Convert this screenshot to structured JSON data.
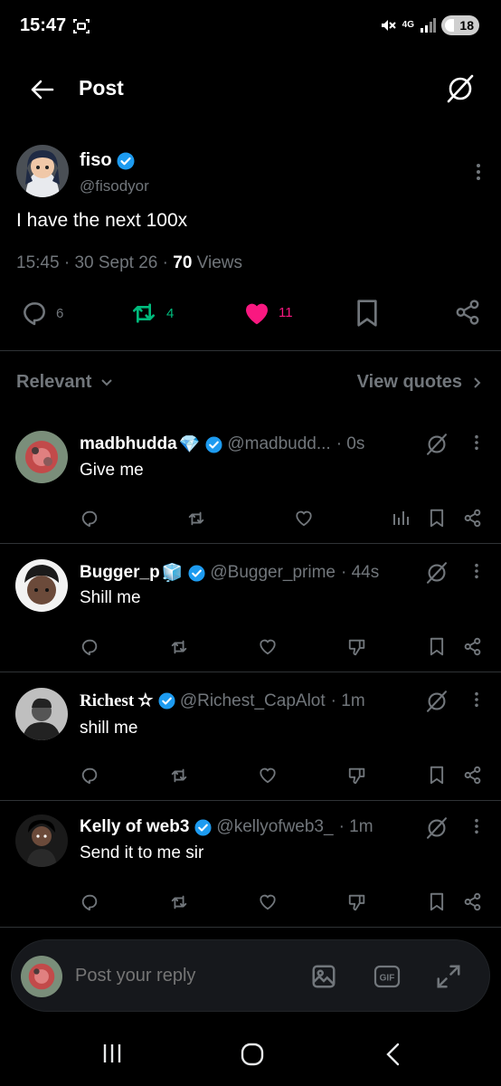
{
  "status_bar": {
    "time": "15:47",
    "network": "4G",
    "battery": "18"
  },
  "header": {
    "title": "Post"
  },
  "post": {
    "author_name": "fiso",
    "author_handle": "@fisodyor",
    "text": "I have the next 100x",
    "time": "15:45",
    "date": "30 Sept 26",
    "views_count": "70",
    "views_label": "Views",
    "replies": "6",
    "reposts": "4",
    "likes": "11",
    "colors": {
      "repost": "#00ba7c",
      "like": "#f91880",
      "verified": "#1d9bf0"
    }
  },
  "filter": {
    "sort_label": "Relevant",
    "quotes_label": "View quotes"
  },
  "replies": [
    {
      "name": "madbhudda",
      "emoji": "💎",
      "handle": "@madbudd...",
      "time": "· 0s",
      "text": "Give me"
    },
    {
      "name": "Bugger_p",
      "emoji": "🧊",
      "handle": "@Bugger_prime",
      "time": "· 44s",
      "text": "Shill me"
    },
    {
      "name": "Richest ✫",
      "handle": "@Richest_CapAlot",
      "time": "· 1m",
      "text": "shill me"
    },
    {
      "name": "Kelly of web3",
      "handle": "@kellyofweb3_",
      "time": "· 1m",
      "text": "Send it to me sir"
    }
  ],
  "composer": {
    "placeholder": "Post your reply"
  },
  "icons": [
    "back-arrow-icon",
    "grok-icon",
    "more-vertical-icon",
    "reply-icon",
    "repost-icon",
    "heart-icon",
    "bookmark-icon",
    "share-icon",
    "chevron-down-icon",
    "chevron-right-icon",
    "analytics-icon",
    "dislike-icon",
    "image-icon",
    "gif-icon",
    "expand-icon",
    "recents-icon",
    "home-icon",
    "nav-back-icon",
    "mute-icon",
    "signal-icon",
    "screenshot-icon"
  ]
}
